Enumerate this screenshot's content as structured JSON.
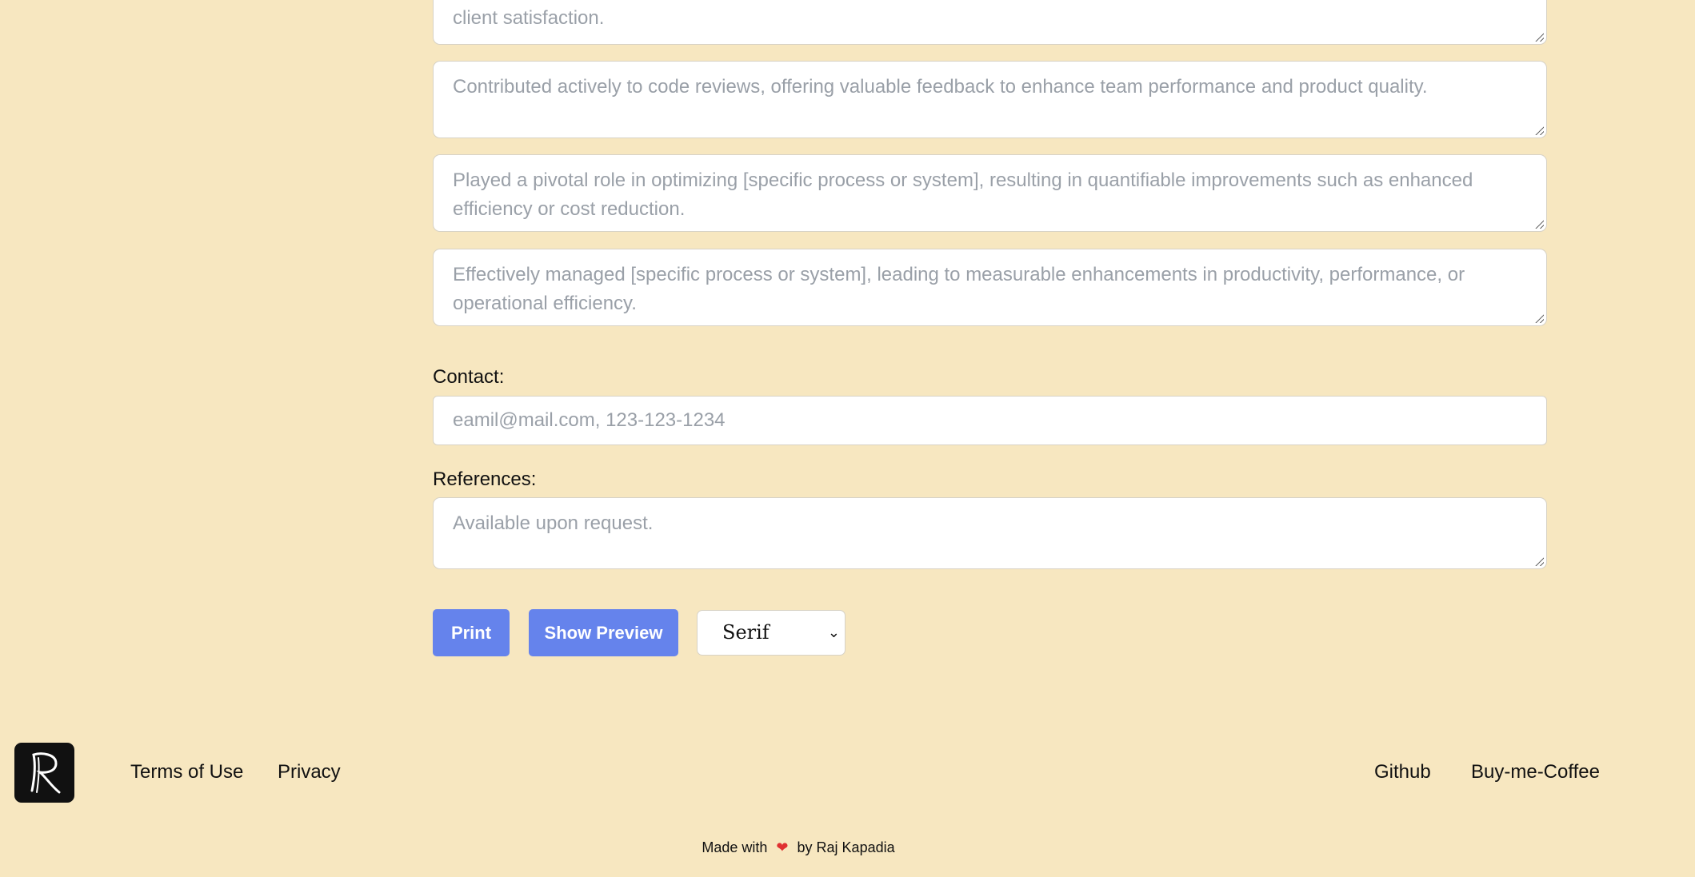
{
  "experience_points": [
    {
      "text": "client satisfaction."
    },
    {
      "text": "Contributed actively to code reviews, offering valuable feedback to enhance team performance and product quality."
    },
    {
      "text": "Played a pivotal role in optimizing [specific process or system], resulting in quantifiable improvements such as enhanced efficiency or cost reduction."
    },
    {
      "text": "Effectively managed [specific process or system], leading to measurable enhancements in productivity, performance, or operational efficiency."
    }
  ],
  "contact": {
    "label": "Contact:",
    "placeholder": "eamil@mail.com, 123-123-1234"
  },
  "references": {
    "label": "References:",
    "placeholder": "Available upon request."
  },
  "actions": {
    "print": "Print",
    "preview": "Show Preview",
    "font_select": "Serif"
  },
  "footer": {
    "terms": "Terms of Use",
    "privacy": "Privacy",
    "github": "Github",
    "coffee": "Buy-me-Coffee",
    "made_prefix": "Made with",
    "made_suffix": "by Raj Kapadia",
    "heart_icon": "heart-icon",
    "logo_icon": "logo-r-icon"
  },
  "colors": {
    "background": "#f7e7c0",
    "button": "#6583ec",
    "heart": "#e03131"
  }
}
